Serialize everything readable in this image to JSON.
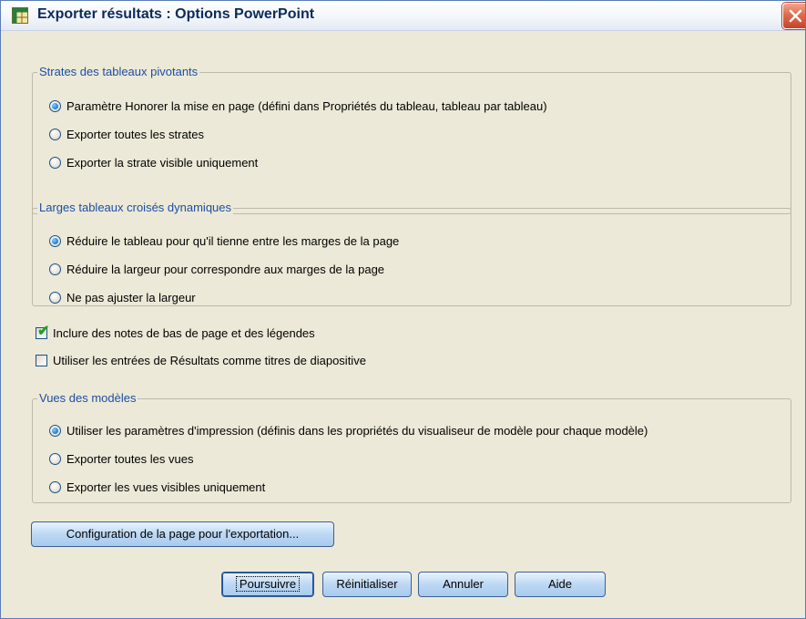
{
  "window": {
    "title": "Exporter résultats : Options PowerPoint",
    "close_label": "✕"
  },
  "group_strates": {
    "label": "Strates des tableaux pivotants",
    "options": [
      {
        "label": "Paramètre Honorer la mise en page (défini dans Propriétés du tableau, tableau par tableau)",
        "selected": true
      },
      {
        "label": "Exporter toutes les strates",
        "selected": false
      },
      {
        "label": "Exporter la strate visible uniquement",
        "selected": false
      }
    ]
  },
  "group_larges": {
    "label": "Larges tableaux croisés dynamiques",
    "options": [
      {
        "label": "Réduire le tableau pour qu'il tienne entre les marges de la page",
        "selected": true
      },
      {
        "label": "Réduire la largeur pour correspondre aux marges de la page",
        "selected": false
      },
      {
        "label": "Ne pas ajuster la largeur",
        "selected": false
      }
    ]
  },
  "checkboxes": [
    {
      "label": "Inclure des notes de bas de page et des légendes",
      "checked": true
    },
    {
      "label": "Utiliser les entrées de Résultats comme titres de diapositive",
      "checked": false
    }
  ],
  "group_vues": {
    "label": "Vues des modèles",
    "options": [
      {
        "label": "Utiliser les paramètres d'impression (définis dans les propriétés du visualiseur de modèle pour chaque modèle)",
        "selected": true
      },
      {
        "label": "Exporter toutes les vues",
        "selected": false
      },
      {
        "label": "Exporter les vues visibles uniquement",
        "selected": false
      }
    ]
  },
  "buttons": {
    "page_setup": "Configuration de la page pour l'exportation...",
    "continue": "Poursuivre",
    "reset": "Réinitialiser",
    "cancel": "Annuler",
    "help": "Aide"
  },
  "colors": {
    "group_label": "#1d4ea3",
    "button_top": "#e9f3fd",
    "button_bottom": "#a9cbee",
    "dialog_bg": "#ece9d8"
  }
}
